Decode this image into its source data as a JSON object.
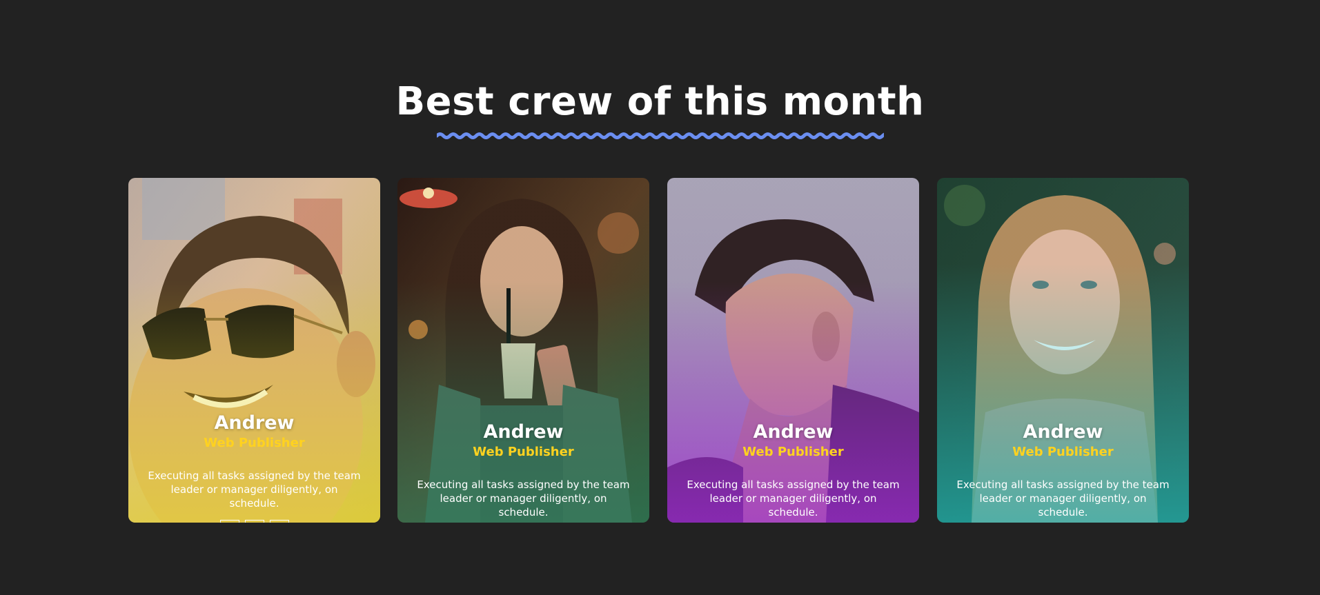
{
  "page": {
    "title": "Best crew of this month",
    "accent_color": "#6b8ef0",
    "background": "#222222"
  },
  "cards": [
    {
      "name": "Andrew",
      "role": "Web Publisher",
      "description": "Executing all tasks assigned by the team leader or manager diligently, on schedule.",
      "overlay_color": "#e6d62a",
      "photo": "man-with-sunglasses-photo",
      "socials": [
        "facebook-icon",
        "twitter-icon",
        "instagram-icon"
      ]
    },
    {
      "name": "Andrew",
      "role": "Web Publisher",
      "description": "Executing all tasks assigned by the team leader or manager diligently, on schedule.",
      "overlay_color": "#2f7d5a",
      "photo": "woman-with-drink-and-phone-photo"
    },
    {
      "name": "Andrew",
      "role": "Web Publisher",
      "description": "Executing all tasks assigned by the team leader or manager diligently, on schedule.",
      "overlay_color": "#a12bd6",
      "photo": "man-in-profile-photo"
    },
    {
      "name": "Andrew",
      "role": "Web Publisher",
      "description": "Executing all tasks assigned by the team leader or manager diligently, on schedule.",
      "overlay_color": "#1fb7b5",
      "photo": "smiling-woman-photo"
    }
  ],
  "colors": {
    "role_text": "#ffd21f",
    "heading_text": "#ffffff"
  }
}
